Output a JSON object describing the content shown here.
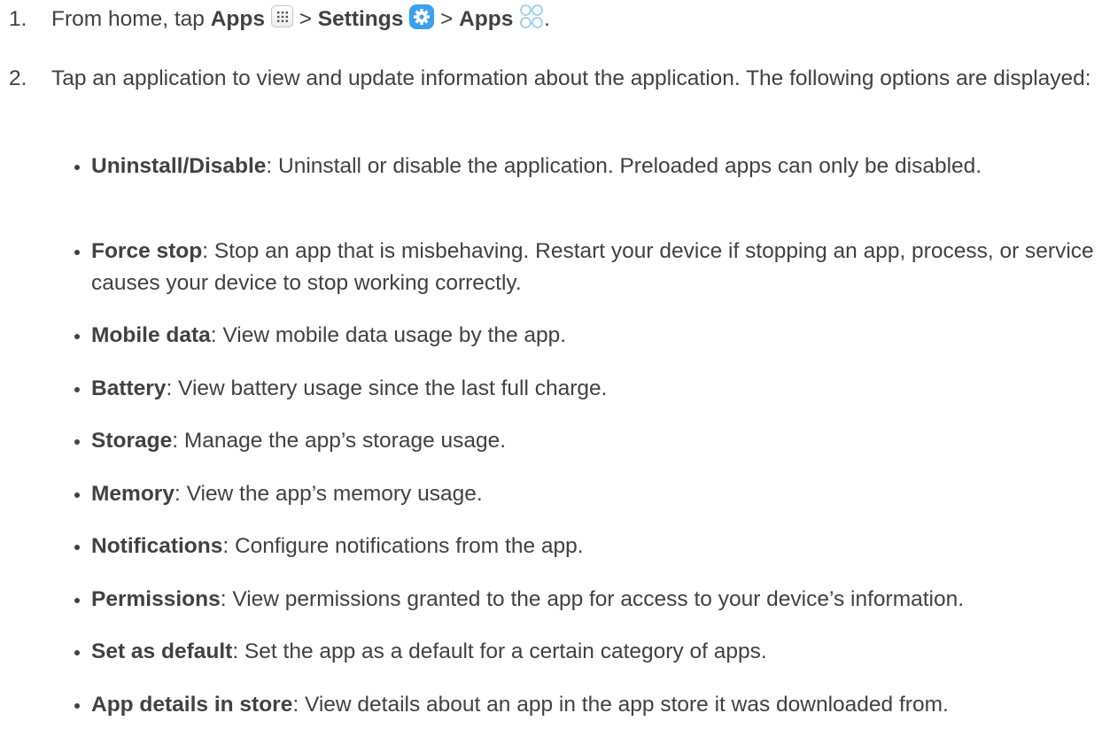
{
  "steps": [
    {
      "number": "1.",
      "intro": "From home, tap ",
      "apps_label": "Apps",
      "sep1": " > ",
      "settings_label": "Settings",
      "sep2": " > ",
      "apps2_label": "Apps",
      "end": "."
    },
    {
      "number": "2.",
      "text": "Tap an application to view and update information about the application. The following options are displayed:"
    }
  ],
  "icons": {
    "apps_grid": "apps-grid-icon",
    "settings": "gear-icon",
    "apps_circles": "apps-circles-icon",
    "settings_color": "#3aa0f0",
    "apps_circles_color": "#8fc9f0"
  },
  "options": [
    {
      "term": "Uninstall/Disable",
      "desc": ": Uninstall or disable the application. Preloaded apps can only be disabled."
    },
    {
      "term": "Force stop",
      "desc": ": Stop an app that is misbehaving. Restart your device if stopping an app, process, or service causes your device to stop working correctly."
    },
    {
      "term": "Mobile data",
      "desc": ": View mobile data usage by the app."
    },
    {
      "term": "Battery",
      "desc": ": View battery usage since the last full charge."
    },
    {
      "term": "Storage",
      "desc": ": Manage the app’s storage usage."
    },
    {
      "term": "Memory",
      "desc": ": View the app’s memory usage."
    },
    {
      "term": "Notifications",
      "desc": ": Configure notifications from the app."
    },
    {
      "term": "Permissions",
      "desc": ": View permissions granted to the app for access to your device’s information."
    },
    {
      "term": "Set as default",
      "desc": ": Set the app as a default for a certain category of apps."
    },
    {
      "term": "App details in store",
      "desc": ": View details about an app in the app store it was downloaded from."
    }
  ]
}
